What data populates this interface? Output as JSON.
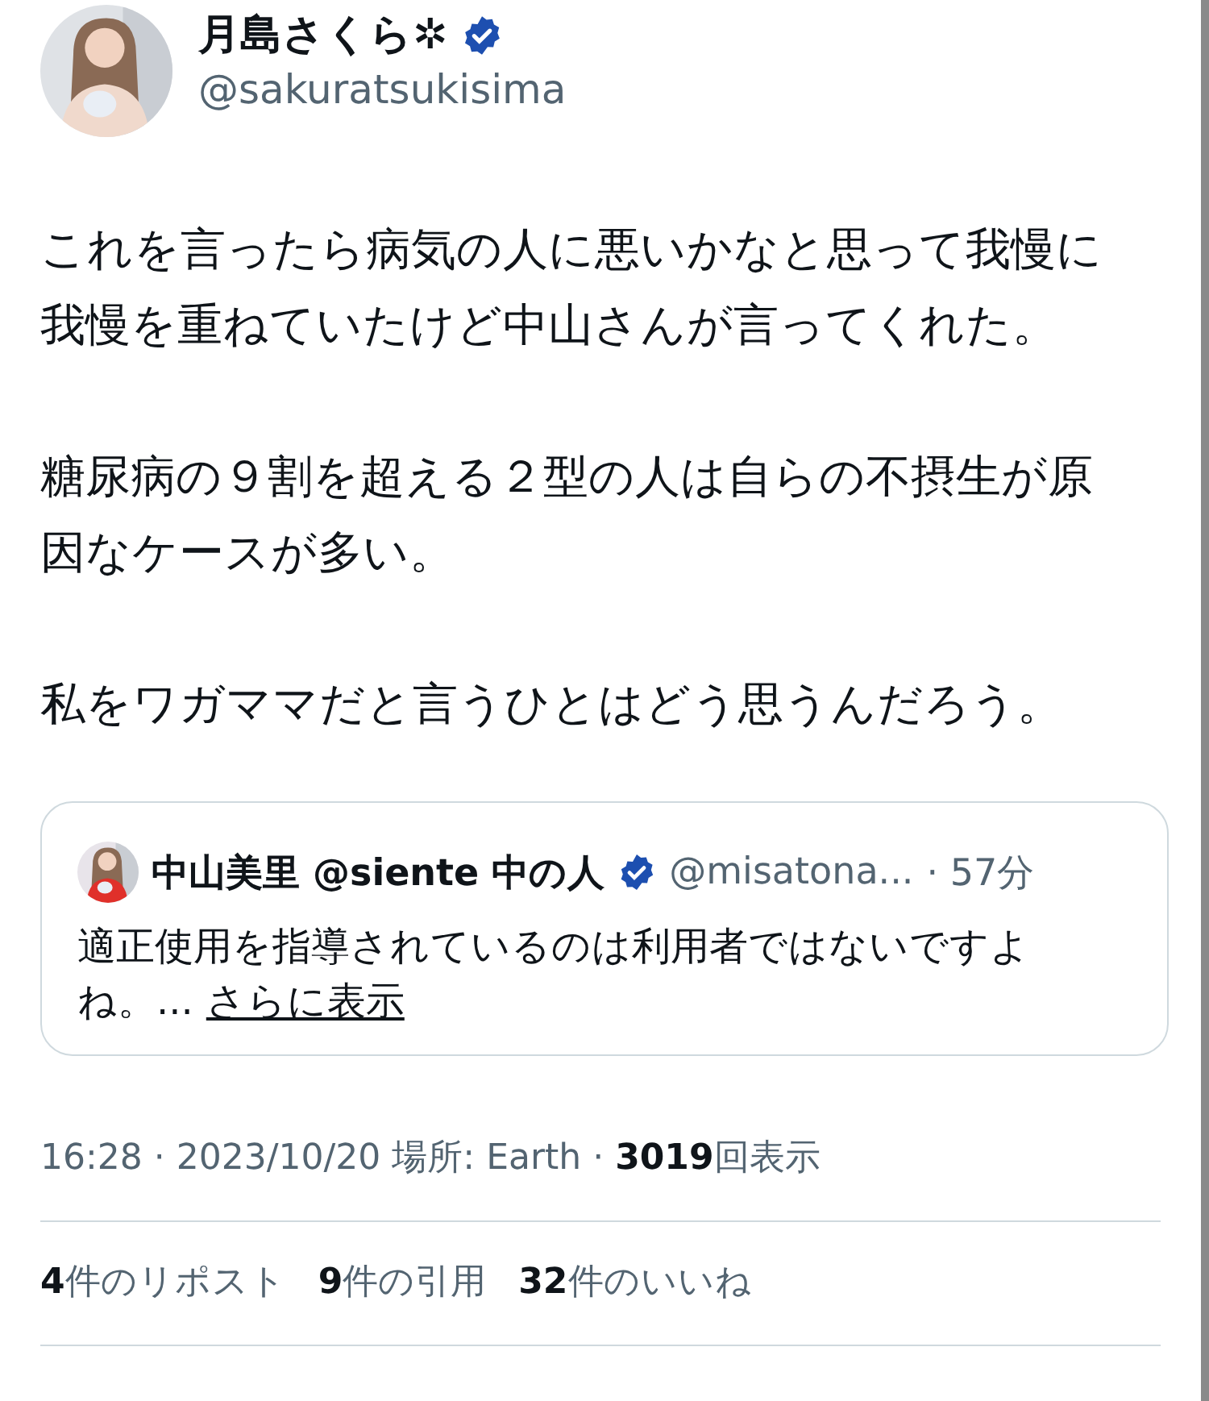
{
  "author": {
    "name": "月島さくら✲",
    "verified": true,
    "handle": "@sakuratsukisima"
  },
  "paragraphs": [
    [
      "これを言ったら病気の人に悪いかなと思って我慢に",
      "我慢を重ねていたけど中山さんが言ってくれた。"
    ],
    [
      "糖尿病の９割を超える２型の人は自らの不摂生が原",
      "因なケースが多い。"
    ],
    [
      "私をワガママだと言うひとはどう思うんだろう。"
    ]
  ],
  "quote": {
    "name": "中山美里 @siente 中の人",
    "verified": true,
    "handle": "@misatona...",
    "time": "· 57分",
    "text": [
      "適正使用を指導されているのは利用者ではないですよ",
      "ね。..."
    ],
    "more": "さらに表示"
  },
  "meta": "16:28 · 2023/10/20 場所: Earth · **3019**回表示",
  "stats": [
    "**4**件のリポスト",
    "**9**件の引用",
    "**32**件のいいね"
  ]
}
